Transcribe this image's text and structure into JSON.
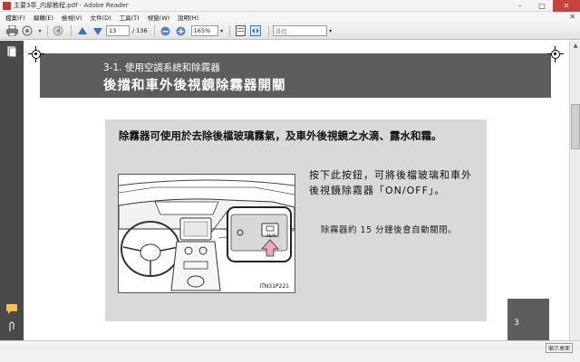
{
  "window": {
    "title": "主要3章_内部教程.pdf - Adobe Reader",
    "min_label": "–",
    "max_label": "□",
    "close_label": "✕"
  },
  "menu": {
    "items": [
      "檔案(F)",
      "編輯(E)",
      "檢視(V)",
      "文件(D)",
      "工具(T)",
      "視窗(W)",
      "說明(H)"
    ],
    "close_label": "✕"
  },
  "toolbar": {
    "page_current": "13",
    "page_total": "/ 136",
    "zoom": "165%",
    "search_placeholder": "尋找"
  },
  "document": {
    "section_number": "3-1. 使用空調系統和除霧器",
    "section_title": "後擋和車外後視鏡除霧器開關",
    "intro": "除霧器可使用於去除後檔玻璃霧氣，及車外後視鏡之水滴、露水和霜。",
    "step": "按下此按鈕，可將後檔玻璃和車外後視鏡除霧器「ON/OFF」。",
    "note": "除霧器約 15 分鐘後會自動關閉。",
    "figure_caption": "ITN31P221",
    "button_label": "REAR",
    "page_number": "3"
  },
  "status": {
    "label": "顯示桌面"
  },
  "colors": {
    "header_band": "#5d5d5d",
    "content_box": "#d9d9d9",
    "left_panel": "#4a4a4a",
    "accent_arrow": "#f2a6c0"
  }
}
